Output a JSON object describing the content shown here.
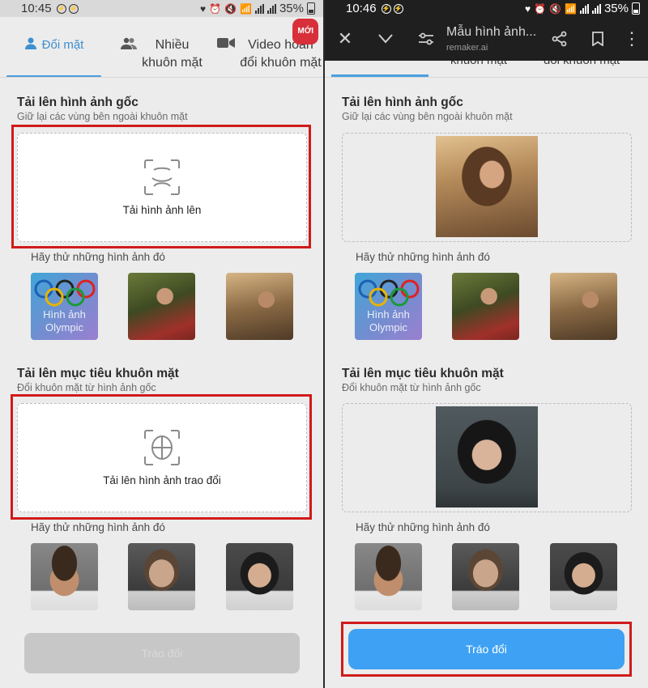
{
  "status_left": {
    "time": "10:45",
    "battery": "35%"
  },
  "status_right": {
    "time": "10:46",
    "battery": "35%"
  },
  "tabs": [
    {
      "label": "Đổi mặt",
      "icon": "person-icon",
      "active": true
    },
    {
      "label_line1": "Nhiều",
      "label_line2": "khuôn mặt",
      "icon": "people-icon"
    },
    {
      "label_line1": "Video hoán",
      "label_line2": "đổi khuôn mặt",
      "icon": "video-camera-icon",
      "badge": "MỚI"
    }
  ],
  "browser": {
    "title": "Mẫu hình ảnh...",
    "url": "remaker.ai"
  },
  "peek_tabs": {
    "t1": "khuôn mặt",
    "t2": "đổi khuôn mặt"
  },
  "original": {
    "title": "Tải lên hình ảnh gốc",
    "subtitle": "Giữ lại các vùng bên ngoài khuôn mặt",
    "upload_label": "Tải hình ảnh lên"
  },
  "target": {
    "title": "Tải lên mục tiêu khuôn mặt",
    "subtitle": "Đổi khuôn mặt từ hình ảnh gốc",
    "upload_label": "Tải lên hình ảnh trao đổi"
  },
  "try_label": "Hãy thử những hình ảnh đó",
  "olympic_label_line1": "Hình ảnh",
  "olympic_label_line2": "Olympic",
  "swap_button": "Tráo đổi",
  "colors": {
    "accent": "#3ea1f3",
    "highlight": "#d11a1a",
    "badge": "#d8303a"
  }
}
